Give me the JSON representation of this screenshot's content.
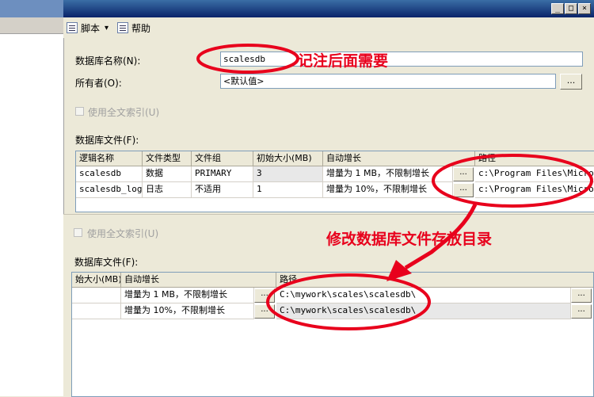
{
  "window": {
    "btn_min": "_",
    "btn_max": "□",
    "btn_close": "×"
  },
  "toolbar": {
    "script_label": "脚本",
    "script_arrow": "▾",
    "help_label": "帮助"
  },
  "form": {
    "db_name_label": "数据库名称(N):",
    "db_name_value": "scalesdb",
    "owner_label": "所有者(O):",
    "owner_value": "<默认值>",
    "browse_label": "...",
    "fulltext_label": "使用全文索引(U)",
    "db_files_label": "数据库文件(F):"
  },
  "grid": {
    "headers": [
      "逻辑名称",
      "文件类型",
      "文件组",
      "初始大小(MB)",
      "自动增长",
      "路径"
    ],
    "rows": [
      {
        "name": "scalesdb",
        "type": "数据",
        "group": "PRIMARY",
        "size": "3",
        "growth": "增量为 1 MB，不限制增长",
        "path": "c:\\Program Files\\Micro"
      },
      {
        "name": "scalesdb_log",
        "type": "日志",
        "group": "不适用",
        "size": "1",
        "growth": "增量为 10%，不限制增长",
        "path": "c:\\Program Files\\Micro"
      }
    ],
    "cell_button": "..."
  },
  "grid2": {
    "headers": [
      "始大小(MB)",
      "自动增长",
      "路径"
    ],
    "rows": [
      {
        "growth": "增量为 1 MB，不限制增长",
        "path": "C:\\mywork\\scales\\scalesdb\\"
      },
      {
        "growth": "增量为 10%，不限制增长",
        "path": "C:\\mywork\\scales\\scalesdb\\"
      }
    ]
  },
  "annotations": {
    "note1": "记注后面需要",
    "note2": "修改数据库文件存放目录",
    "color": "#e8001c"
  }
}
